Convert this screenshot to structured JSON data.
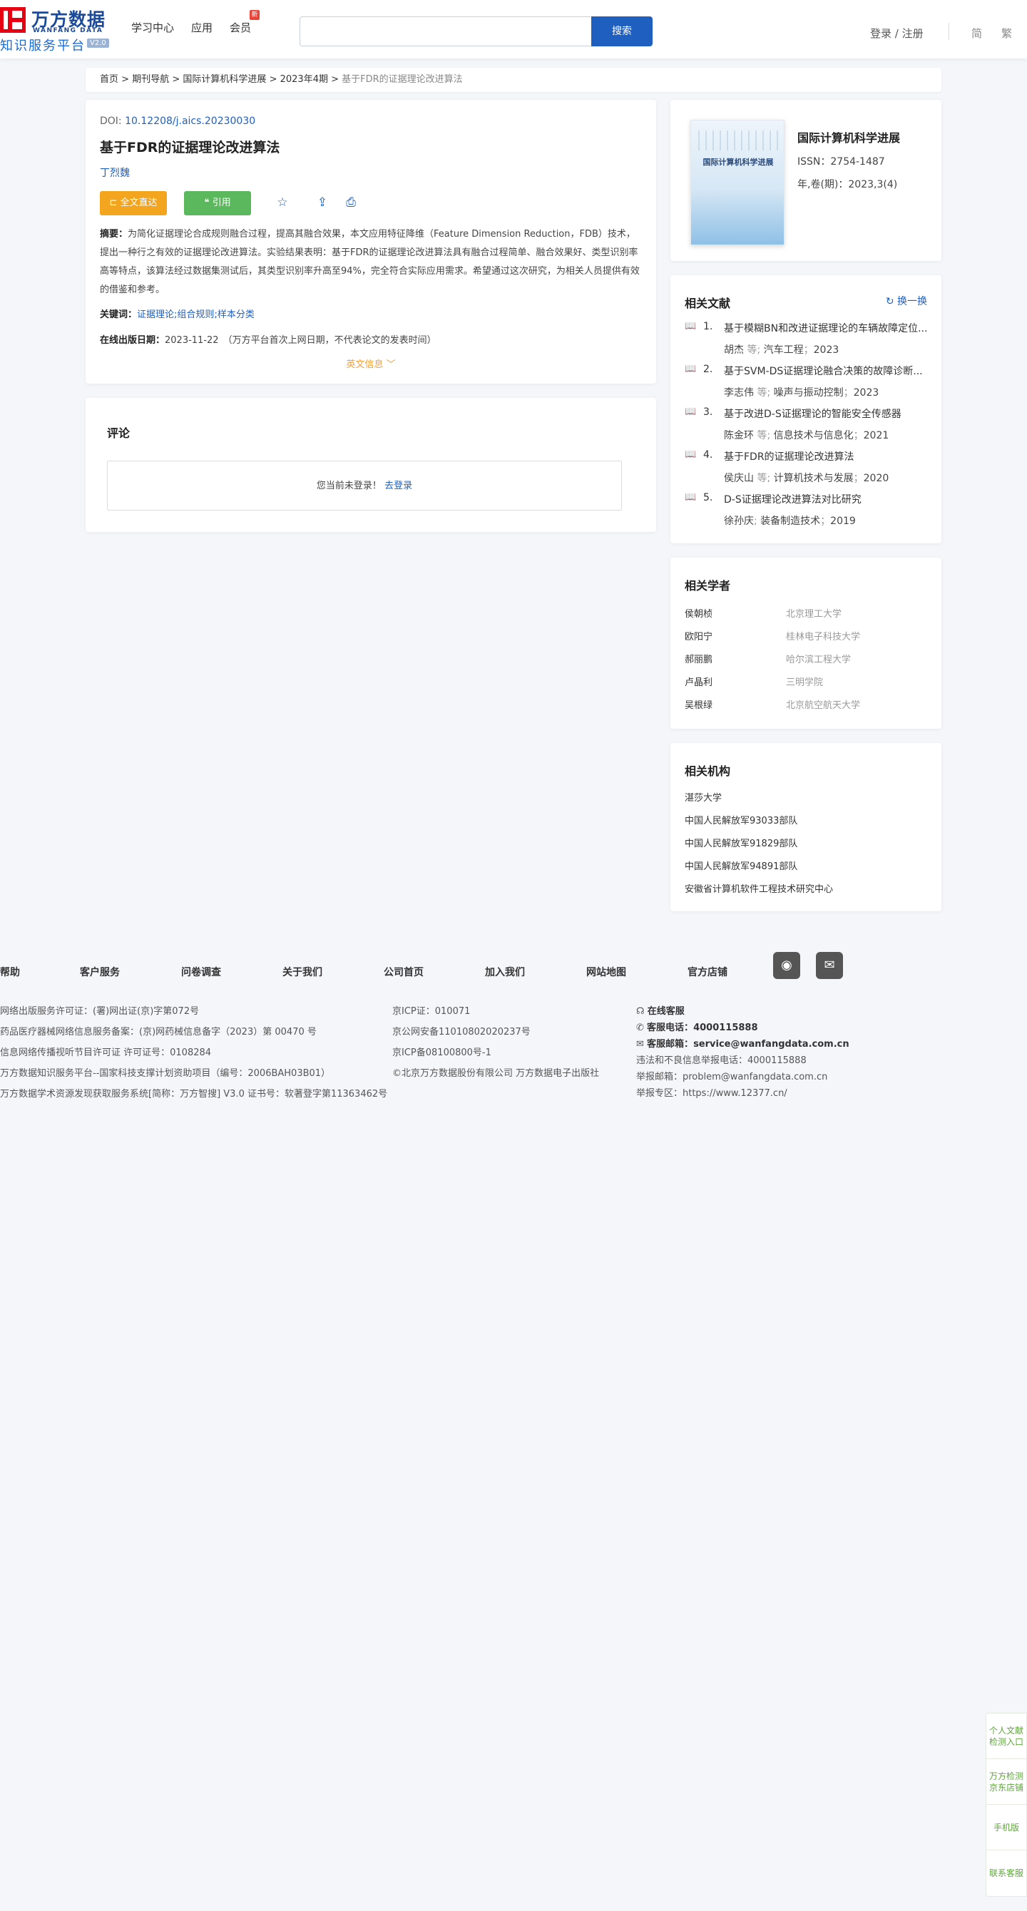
{
  "header": {
    "logo_cn": "万方数据",
    "logo_en": "WANFANG DATA",
    "logo_sub": "知识服务平台",
    "logo_ver": "V2.0",
    "nav": [
      "学习中心",
      "应用",
      "会员"
    ],
    "member_badge": "新",
    "search_placeholder": "",
    "search_button": "搜索",
    "login": "登录 / 注册",
    "lang_simplified": "简",
    "lang_traditional": "繁"
  },
  "breadcrumb": {
    "items": [
      "首页",
      "期刊导航",
      "国际计算机科学进展",
      "2023年4期"
    ],
    "separator": ">",
    "current": "基于FDR的证据理论改进算法"
  },
  "article": {
    "doi_label": "DOI:",
    "doi": "10.12208/j.aics.20230030",
    "title": "基于FDR的证据理论改进算法",
    "author": "丁烈魏",
    "btn_fulltext": "全文直达",
    "btn_cite": "引用",
    "abstract_label": "摘要：",
    "abstract": "为简化证据理论合成规则融合过程，提高其融合效果，本文应用特征降维（Feature Dimension Reduction，FDB）技术，提出一种行之有效的证据理论改进算法。实验结果表明：基于FDR的证据理论改进算法具有融合过程简单、融合效果好、类型识别率高等特点，该算法经过数据集测试后，其类型识别率升高至94%，完全符合实际应用需求。希望通过这次研究，为相关人员提供有效的借鉴和参考。",
    "keywords_label": "关键词：",
    "keywords": [
      "证据理论",
      "组合规则",
      "样本分类"
    ],
    "pubdate_label": "在线出版日期：",
    "pubdate": "2023-11-22",
    "pubdate_note": "（万方平台首次上网日期，不代表论文的发表时间）",
    "en_info": "英文信息"
  },
  "comments": {
    "title": "评论",
    "not_logged_in": "您当前未登录！",
    "login_link": "去登录"
  },
  "journal": {
    "cover_title": "国际计算机科学进展",
    "name": "国际计算机科学进展",
    "issn": "ISSN：2754-1487",
    "issue": "年,卷(期)：2023,3(4)"
  },
  "related_docs": {
    "title": "相关文献",
    "refresh": "换一换",
    "items": [
      {
        "num": "1.",
        "title": "基于模糊BN和改进证据理论的车辆故障定位...",
        "author": "胡杰",
        "suffix": "等;",
        "source": "汽车工程",
        "year": "2023"
      },
      {
        "num": "2.",
        "title": "基于SVM-DS证据理论融合决策的故障诊断...",
        "author": "李志伟",
        "suffix": "等;",
        "source": "噪声与振动控制",
        "year": "2023"
      },
      {
        "num": "3.",
        "title": "基于改进D-S证据理论的智能安全传感器",
        "author": "陈金环",
        "suffix": "等;",
        "source": "信息技术与信息化",
        "year": "2021"
      },
      {
        "num": "4.",
        "title": "基于FDR的证据理论改进算法",
        "author": "侯庆山",
        "suffix": "等;",
        "source": "计算机技术与发展",
        "year": "2020"
      },
      {
        "num": "5.",
        "title": "D-S证据理论改进算法对比研究",
        "author": "徐孙庆",
        "suffix": ";",
        "source": "装备制造技术",
        "year": "2019"
      }
    ]
  },
  "scholars": {
    "title": "相关学者",
    "items": [
      {
        "name": "侯朝桢",
        "org": "北京理工大学"
      },
      {
        "name": "欧阳宁",
        "org": "桂林电子科技大学"
      },
      {
        "name": "郝丽鹏",
        "org": "哈尔滨工程大学"
      },
      {
        "name": "卢晶利",
        "org": "三明学院"
      },
      {
        "name": "吴根绿",
        "org": "北京航空航天大学"
      }
    ]
  },
  "institutions": {
    "title": "相关机构",
    "items": [
      "湛莎大学",
      "中国人民解放军93033部队",
      "中国人民解放军91829部队",
      "中国人民解放军94891部队",
      "安徽省计算机软件工程技术研究中心"
    ]
  },
  "footer": {
    "nav": [
      "帮助",
      "客户服务",
      "问卷调查",
      "关于我们",
      "公司首页",
      "加入我们",
      "网站地图",
      "官方店铺"
    ],
    "col1": [
      "网络出版服务许可证：(署)网出证(京)字第072号",
      "药品医疗器械网络信息服务备案：(京)网药械信息备字（2023）第 00470 号",
      "信息网络传播视听节目许可证 许可证号：0108284",
      "万方数据知识服务平台--国家科技支撑计划资助项目（编号：2006BAH03B01）",
      "万方数据学术资源发现获取服务系统[简称：万方智搜] V3.0 证书号：软著登字第11363462号"
    ],
    "col2": [
      "京ICP证：010071",
      "京公网安备11010802020237号",
      "京ICP备08100800号-1",
      "©北京万方数据股份有限公司 万方数据电子出版社"
    ],
    "online_service": "在线客服",
    "phone_label": "客服电话：",
    "phone": "4000115888",
    "email_label": "客服邮箱：",
    "email": "service@wanfangdata.com.cn",
    "report_phone": "违法和不良信息举报电话：4000115888",
    "report_email": "举报邮箱：problem@wanfangdata.com.cn",
    "report_zone": "举报专区：https://www.12377.cn/"
  },
  "float": [
    "个人文献检测入口",
    "万方检测京东店铺",
    "手机版",
    "联系客服"
  ]
}
